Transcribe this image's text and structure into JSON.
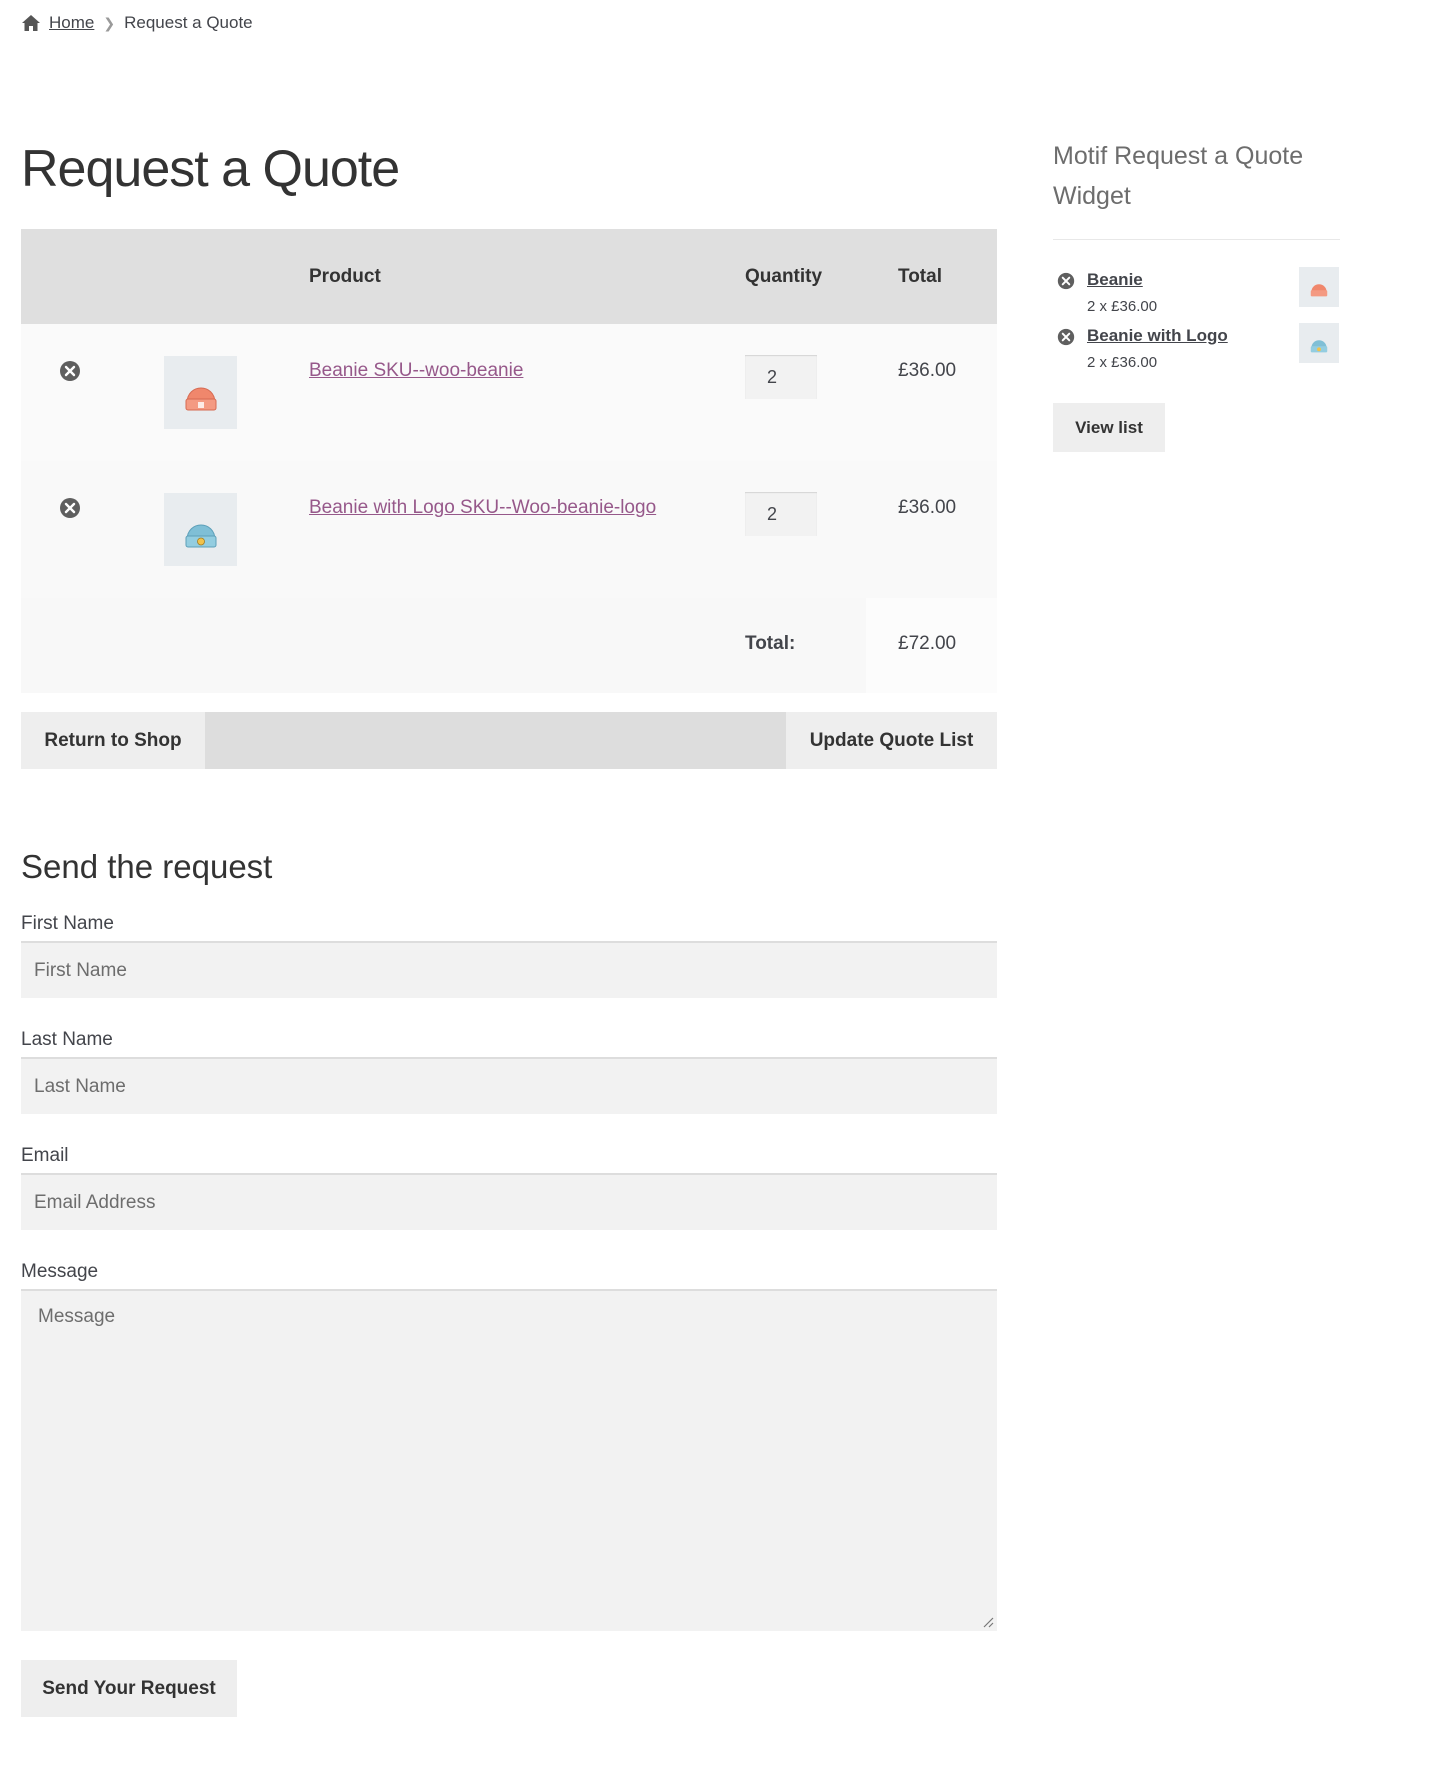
{
  "breadcrumb": {
    "home": "Home",
    "current": "Request a Quote"
  },
  "page": {
    "title": "Request a Quote"
  },
  "table": {
    "headers": {
      "product": "Product",
      "quantity": "Quantity",
      "total": "Total"
    },
    "rows": [
      {
        "product": "Beanie SKU--woo-beanie",
        "qty": "2",
        "total": "£36.00",
        "thumb_color": "#f0876c",
        "thumb_icon": "beanie-orange-icon"
      },
      {
        "product": "Beanie with Logo SKU--Woo-beanie-logo",
        "qty": "2",
        "total": "£36.00",
        "thumb_color": "#7fbfd6",
        "thumb_icon": "beanie-blue-logo-icon"
      }
    ],
    "total_label": "Total:",
    "total_value": "£72.00"
  },
  "actions": {
    "return_label": "Return to Shop",
    "update_label": "Update Quote List"
  },
  "form": {
    "heading": "Send the request",
    "first_name": {
      "label": "First Name",
      "placeholder": "First Name"
    },
    "last_name": {
      "label": "Last Name",
      "placeholder": "Last Name"
    },
    "email": {
      "label": "Email",
      "placeholder": "Email Address"
    },
    "message": {
      "label": "Message",
      "placeholder": "Message"
    },
    "submit_label": "Send Your Request"
  },
  "widget": {
    "title": "Motif Request a Quote Widget",
    "items": [
      {
        "name": "Beanie",
        "meta": "2 x £36.00"
      },
      {
        "name": "Beanie with Logo",
        "meta": "2 x £36.00"
      }
    ],
    "view_list_label": "View list"
  },
  "colors": {
    "link": "#96588a",
    "header_bg": "#dfdfdf",
    "button_bg": "#eeeeee",
    "input_bg": "#f2f2f2"
  }
}
